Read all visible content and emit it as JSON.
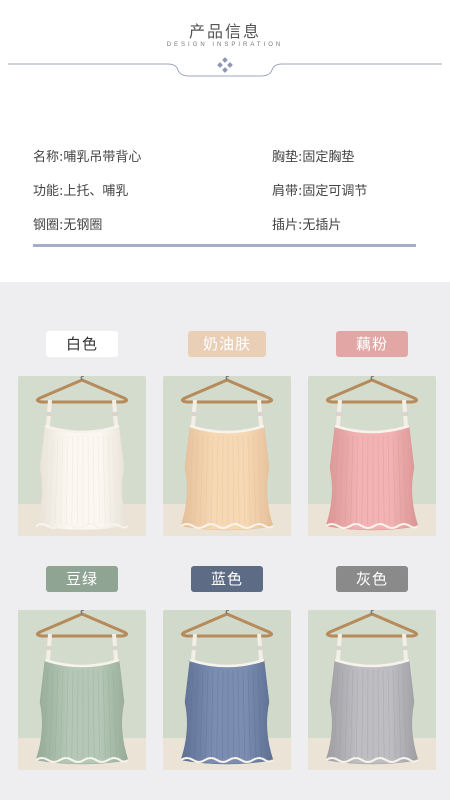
{
  "header": {
    "title": "产品信息",
    "subtitle": "DESIGN INSPIRATION"
  },
  "specs": [
    {
      "key": "名称:",
      "value": "哺乳吊带背心"
    },
    {
      "key": "胸垫:",
      "value": "固定胸垫"
    },
    {
      "key": "功能:",
      "value": "上托、哺乳"
    },
    {
      "key": "肩带:",
      "value": "固定可调节"
    },
    {
      "key": "钢圈:",
      "value": "无钢圈"
    },
    {
      "key": "插片:",
      "value": "无插片"
    }
  ],
  "colors": [
    {
      "label": "白色",
      "tag_bg": "#ffffff",
      "tag_fg": "#333333",
      "top": "#fbf8f1",
      "shade": "#e7e1d6",
      "backdrop": "#d4dccd"
    },
    {
      "label": "奶油肤",
      "tag_bg": "#e9cfb6",
      "tag_fg": "#ffffff",
      "top": "#f6d8b4",
      "shade": "#e4bf98",
      "backdrop": "#d2dbcc"
    },
    {
      "label": "藕粉",
      "tag_bg": "#e2a7a5",
      "tag_fg": "#ffffff",
      "top": "#f1b3b3",
      "shade": "#da9594",
      "backdrop": "#d4dccd"
    },
    {
      "label": "豆绿",
      "tag_bg": "#8fa492",
      "tag_fg": "#ffffff",
      "top": "#b5c7b6",
      "shade": "#95ab97",
      "backdrop": "#d3dbcc"
    },
    {
      "label": "蓝色",
      "tag_bg": "#5d6b84",
      "tag_fg": "#ffffff",
      "top": "#7b8db0",
      "shade": "#5d6f93",
      "backdrop": "#d1d9cb"
    },
    {
      "label": "灰色",
      "tag_bg": "#8a8a8a",
      "tag_fg": "#ffffff",
      "top": "#bebec2",
      "shade": "#9d9da3",
      "backdrop": "#d3dbcc"
    }
  ]
}
